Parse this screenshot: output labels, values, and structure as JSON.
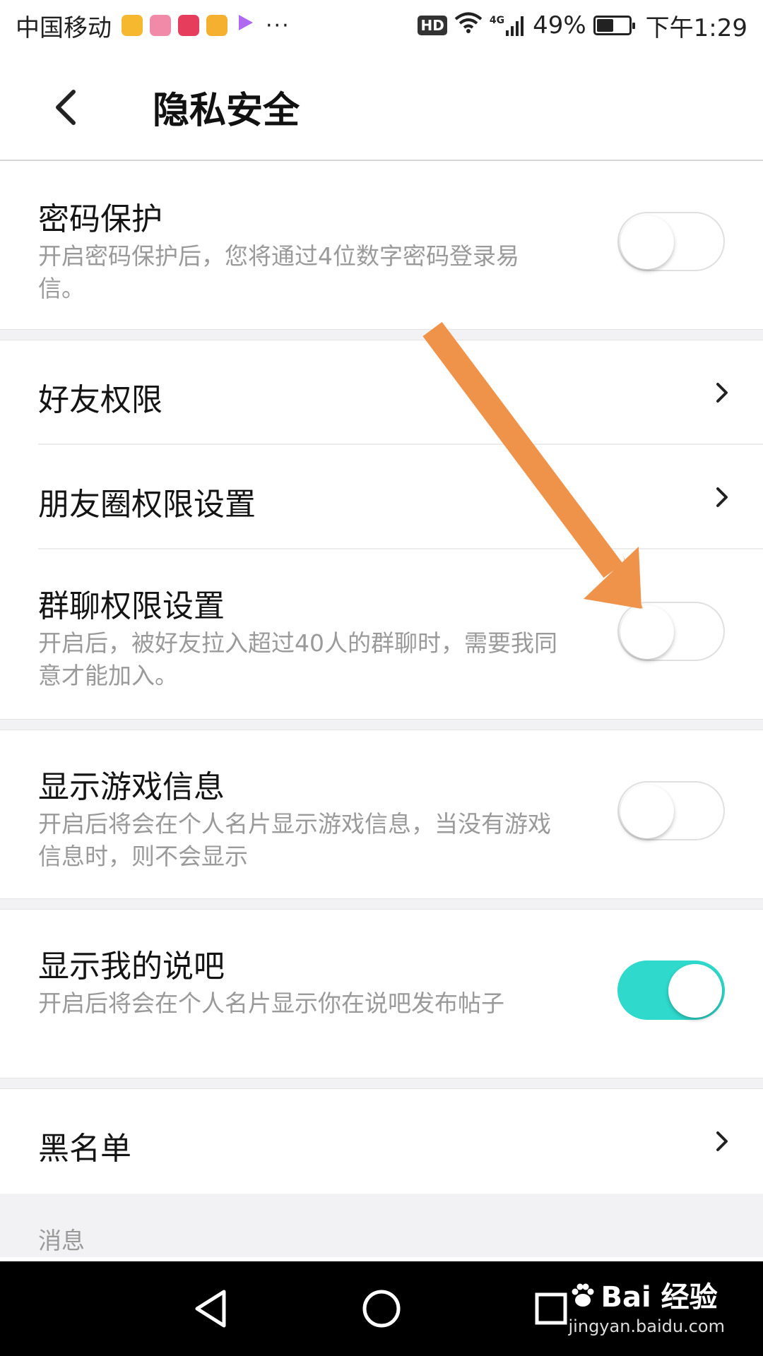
{
  "status_bar": {
    "carrier": "中国移动",
    "more": "···",
    "hd": "HD",
    "network": "4G",
    "battery": "49%",
    "battery_level": 0.49,
    "time": "下午1:29",
    "app_icons": [
      {
        "name": "weibo-icon",
        "color": "#f5b82e"
      },
      {
        "name": "app-pink-icon",
        "color": "#f08aa8"
      },
      {
        "name": "app-heart-icon",
        "color": "#e63d5c"
      },
      {
        "name": "app-yue-icon",
        "color": "#f5b030"
      },
      {
        "name": "video-play-icon",
        "color": "#b06af0"
      }
    ]
  },
  "header": {
    "title": "隐私安全"
  },
  "settings": {
    "password": {
      "title": "密码保护",
      "desc": "开启密码保护后，您将通过4位数字密码登录易信。",
      "enabled": false
    },
    "friend_perm": {
      "title": "好友权限"
    },
    "moments_perm": {
      "title": "朋友圈权限设置"
    },
    "group_perm": {
      "title": "群聊权限设置",
      "desc": "开启后，被好友拉入超过40人的群聊时，需要我同意才能加入。",
      "enabled": false
    },
    "game_info": {
      "title": "显示游戏信息",
      "desc": "开启后将会在个人名片显示游戏信息，当没有游戏信息时，则不会显示",
      "enabled": false
    },
    "shuoba": {
      "title": "显示我的说吧",
      "desc": "开启后将会在个人名片显示你在说吧发布帖子",
      "enabled": true
    },
    "blacklist": {
      "title": "黑名单"
    }
  },
  "section_message": "消息",
  "watermark": {
    "brand": "Bai 经验",
    "url": "jingyan.baidu.com"
  },
  "colors": {
    "accent": "#2fd9cc",
    "arrow": "#f0934a"
  }
}
